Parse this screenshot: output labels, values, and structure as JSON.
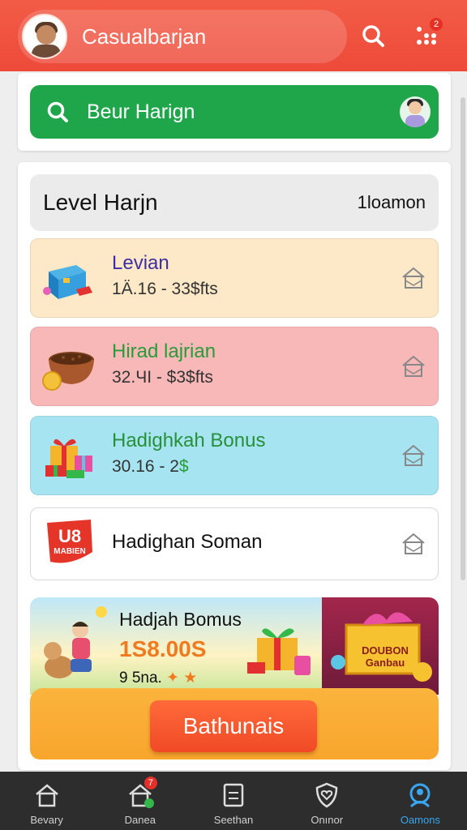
{
  "header": {
    "title": "Casualbarjan",
    "apps_badge": "2"
  },
  "search": {
    "text": "Beur Harign"
  },
  "section": {
    "title": "Level Harjn",
    "right_label": "1loamon"
  },
  "rows": [
    {
      "title": "Levian",
      "subtitle": "1Ä.16 - 33$fts",
      "icon": "toolbox-icon"
    },
    {
      "title": "Hirad lajrian",
      "subtitle": "32.ЧI - $3$fts",
      "icon": "basket-icon"
    },
    {
      "title": "Hadighkah Bonus",
      "subtitle": "30.16 - 2",
      "subtitle_accent": "$",
      "icon": "gift-boxes-icon"
    },
    {
      "title": "Hadighan Soman",
      "subtitle": "",
      "icon": "red-logo-icon",
      "logo_text": "U8",
      "logo_sub": "MABIEN"
    }
  ],
  "promo": {
    "title": "Hadjah Bomus",
    "amount": "1S8.00S",
    "sub": "9 5na.",
    "sign_text": "DOUBON Ganbau",
    "cta": "Bathunais"
  },
  "nav": [
    {
      "label": "Bevary",
      "icon": "home-icon",
      "active": false
    },
    {
      "label": "Danea",
      "icon": "house-badge-icon",
      "badge": "7",
      "active": false
    },
    {
      "label": "Seethan",
      "icon": "clipboard-icon",
      "active": false
    },
    {
      "label": "Onınor",
      "icon": "shield-heart-icon",
      "active": false
    },
    {
      "label": "Oamons",
      "icon": "profile-icon",
      "active": true
    }
  ],
  "colors": {
    "header": "#ee4a3a",
    "search_bar": "#1fa64a",
    "cta": "#f04a26",
    "nav_active": "#39a6ef"
  }
}
